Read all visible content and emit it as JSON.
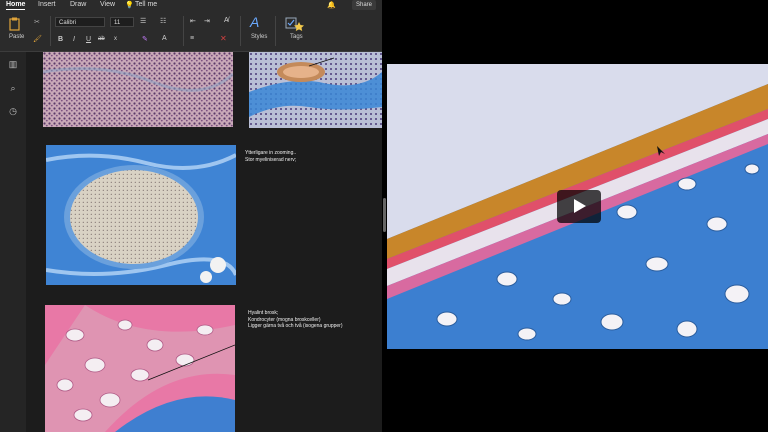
{
  "menu": {
    "tabs": [
      "Home",
      "Insert",
      "Draw",
      "View"
    ],
    "tell_me": "Tell me",
    "share": "Share"
  },
  "ribbon": {
    "paste_label": "Paste",
    "font_name": "Calibri",
    "font_size": "11",
    "bold": "B",
    "italic": "I",
    "underline": "U",
    "strike": "ab",
    "subscript": "x",
    "styles_label": "Styles",
    "tags_label": "Tags"
  },
  "notes": {
    "nerve": [
      "Ytterligare in zooming..",
      "Stor myeliniserad nerv;"
    ],
    "cartilage": [
      "Hyalint brosk;",
      "",
      "Kondrocyter (mogna broskceller)",
      "Ligger gärna två och två (isogena grupper)"
    ]
  },
  "icons": {
    "library": "library-icon",
    "search": "search-icon",
    "history": "clock-icon"
  },
  "colors": {
    "app_bg": "#1f1f1f",
    "ribbon_bg": "#2b2b2b",
    "tissue_blue": "#3c7fd0",
    "tissue_pink": "#e86aa0",
    "tissue_orange": "#c8862a"
  }
}
